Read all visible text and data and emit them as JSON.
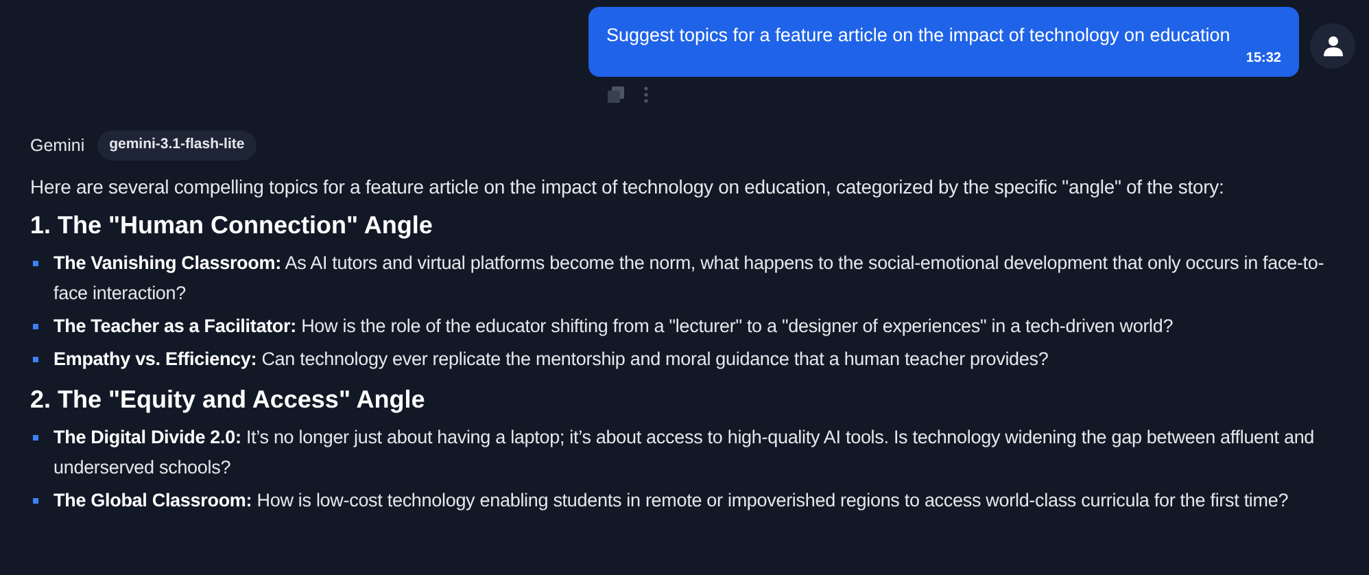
{
  "user_message": {
    "text": "Suggest topics for a feature article on the impact of technology on education",
    "time": "15:32"
  },
  "reply": {
    "sender": "Gemini",
    "model": "gemini-3.1-flash-lite",
    "intro": "Here are several compelling topics for a feature article on the impact of technology on education, categorized by the specific \"angle\" of the story:",
    "sections": [
      {
        "heading": "1. The \"Human Connection\" Angle",
        "items": [
          "**The Vanishing Classroom:** As AI tutors and virtual platforms become the norm, what happens to the social-emotional development that only occurs in face-to-face interaction?",
          "**The Teacher as a Facilitator:** How is the role of the educator shifting from a \"lecturer\" to a \"designer of experiences\" in a tech-driven world?",
          "**Empathy vs. Efficiency:** Can technology ever replicate the mentorship and moral guidance that a human teacher provides?"
        ]
      },
      {
        "heading": "2. The \"Equity and Access\" Angle",
        "items": [
          "**The Digital Divide 2.0:** It’s no longer just about having a laptop; it’s about access to high-quality AI tools. Is technology widening the gap between affluent and underserved schools?",
          "**The Global Classroom:** How is low-cost technology enabling students in remote or impoverished regions to access world-class curricula for the first time?"
        ]
      }
    ]
  }
}
